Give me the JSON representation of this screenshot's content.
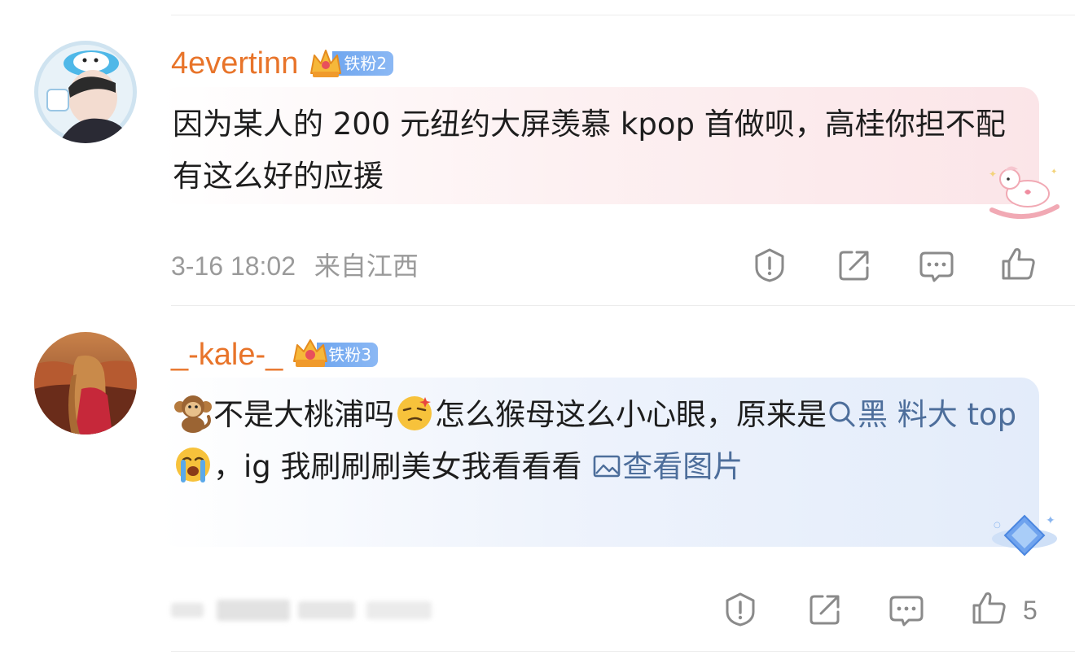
{
  "comments": [
    {
      "username": "4evertinn",
      "badge": "铁粉2",
      "text_parts": [
        "因为某人的 200 元纽约大屏羡慕 kpop 首做呗，高桂你担不配有这么好的应援"
      ],
      "timestamp": "3-16 18:02",
      "location": "来自江西",
      "like_count": ""
    },
    {
      "username": "_-kale-_",
      "badge": "铁粉3",
      "text_parts": [
        "不是大桃浦吗",
        "怎么猴母这么小心眼，原来是",
        "黑 料大 top",
        "，ig 我刷刷刷美女我看看看",
        "查看图片"
      ],
      "emoji_names": [
        "monkey-emoji",
        "smirk-emoji",
        "crying-emoji"
      ],
      "timestamp": "",
      "location": "",
      "like_count": "5"
    }
  ],
  "icons": {
    "report": "report-icon",
    "share": "share-icon",
    "comment": "comment-icon",
    "like": "like-icon",
    "search": "search-icon",
    "image": "image-icon",
    "crown": "crown-icon"
  },
  "colors": {
    "username": "#e8742a",
    "link": "#4d6e9b",
    "meta": "#9a9a9a",
    "badge": "#6fa6ef",
    "text": "#1d1d1d"
  }
}
